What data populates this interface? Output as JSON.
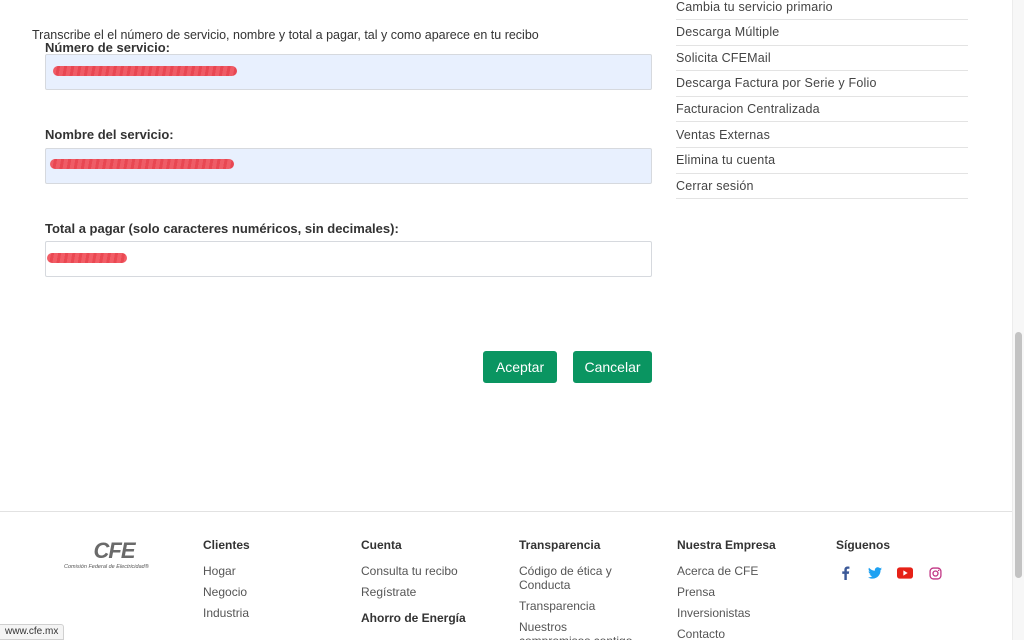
{
  "form": {
    "instruction": "Transcribe el el número de servicio, nombre y total a pagar, tal y como aparece en tu recibo",
    "service_number_label": "Número de servicio:",
    "service_number_value": "",
    "service_name_label": "Nombre del servicio:",
    "service_name_value": "",
    "total_label": "Total a pagar (solo caracteres numéricos, sin decimales):",
    "total_value": "",
    "accept_label": "Aceptar",
    "cancel_label": "Cancelar"
  },
  "side_menu": {
    "items": [
      "Cambia tu servicio primario",
      "Descarga Múltiple",
      "Solicita CFEMail",
      "Descarga Factura por Serie y Folio",
      "Facturacion Centralizada",
      "Ventas Externas",
      "Elimina tu cuenta",
      "Cerrar sesión"
    ]
  },
  "footer": {
    "logo_text": "CFE",
    "logo_subtitle": "Comisión Federal de Electricidad®",
    "clientes": {
      "heading": "Clientes",
      "links": [
        "Hogar",
        "Negocio",
        "Industria"
      ]
    },
    "cuenta": {
      "heading": "Cuenta",
      "links": [
        "Consulta tu recibo",
        "Regístrate"
      ],
      "subheading": "Ahorro de Energía"
    },
    "transparencia": {
      "heading": "Transparencia",
      "links": [
        "Código de ética y Conducta",
        "Transparencia",
        "Nuestros compromisos contigo"
      ]
    },
    "empresa": {
      "heading": "Nuestra Empresa",
      "links": [
        "Acerca de CFE",
        "Prensa",
        "Inversionistas",
        "Contacto"
      ]
    },
    "siguenos": {
      "heading": "Síguenos",
      "icons": [
        "facebook-icon",
        "twitter-icon",
        "youtube-icon",
        "instagram-icon"
      ]
    }
  },
  "statusbar": {
    "url": "www.cfe.mx"
  },
  "colors": {
    "accent": "#0a9561",
    "input_autofill": "#e8f0fe",
    "facebook": "#3b5998",
    "twitter": "#1da1f2",
    "youtube": "#e62117",
    "instagram": "#c13584"
  }
}
